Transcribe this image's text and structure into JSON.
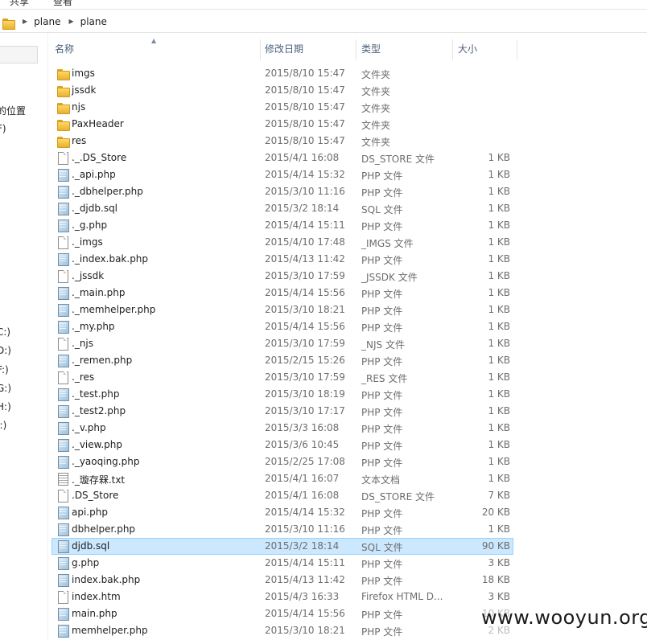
{
  "window": {
    "menu_items": [
      "共享",
      "查看"
    ]
  },
  "address_bar": {
    "breadcrumbs": [
      "plane",
      "plane"
    ]
  },
  "nav_pane": {
    "fragments": [
      "的位置",
      "F)",
      "C:)",
      "D:)",
      "F:)",
      "G:)",
      "H:)",
      "I:)"
    ]
  },
  "columns": {
    "name": "名称",
    "modified": "修改日期",
    "type": "类型",
    "size": "大小"
  },
  "files": [
    {
      "name": "imgs",
      "modified": "2015/8/10 15:47",
      "type": "文件夹",
      "size": "",
      "icon": "folder-icon"
    },
    {
      "name": "jssdk",
      "modified": "2015/8/10 15:47",
      "type": "文件夹",
      "size": "",
      "icon": "folder-icon"
    },
    {
      "name": "njs",
      "modified": "2015/8/10 15:47",
      "type": "文件夹",
      "size": "",
      "icon": "folder-icon"
    },
    {
      "name": "PaxHeader",
      "modified": "2015/8/10 15:47",
      "type": "文件夹",
      "size": "",
      "icon": "folder-icon"
    },
    {
      "name": "res",
      "modified": "2015/8/10 15:47",
      "type": "文件夹",
      "size": "",
      "icon": "folder-icon"
    },
    {
      "name": "._.DS_Store",
      "modified": "2015/4/1 16:08",
      "type": "DS_STORE 文件",
      "size": "1 KB",
      "icon": "file-icon"
    },
    {
      "name": "._api.php",
      "modified": "2015/4/14 15:32",
      "type": "PHP 文件",
      "size": "1 KB",
      "icon": "php-file-icon"
    },
    {
      "name": "._dbhelper.php",
      "modified": "2015/3/10 11:16",
      "type": "PHP 文件",
      "size": "1 KB",
      "icon": "php-file-icon"
    },
    {
      "name": "._djdb.sql",
      "modified": "2015/3/2 18:14",
      "type": "SQL 文件",
      "size": "1 KB",
      "icon": "php-file-icon"
    },
    {
      "name": "._g.php",
      "modified": "2015/4/14 15:11",
      "type": "PHP 文件",
      "size": "1 KB",
      "icon": "php-file-icon"
    },
    {
      "name": "._imgs",
      "modified": "2015/4/10 17:48",
      "type": "_IMGS 文件",
      "size": "1 KB",
      "icon": "file-icon"
    },
    {
      "name": "._index.bak.php",
      "modified": "2015/4/13 11:42",
      "type": "PHP 文件",
      "size": "1 KB",
      "icon": "php-file-icon"
    },
    {
      "name": "._jssdk",
      "modified": "2015/3/10 17:59",
      "type": "_JSSDK 文件",
      "size": "1 KB",
      "icon": "file-icon"
    },
    {
      "name": "._main.php",
      "modified": "2015/4/14 15:56",
      "type": "PHP 文件",
      "size": "1 KB",
      "icon": "php-file-icon"
    },
    {
      "name": "._memhelper.php",
      "modified": "2015/3/10 18:21",
      "type": "PHP 文件",
      "size": "1 KB",
      "icon": "php-file-icon"
    },
    {
      "name": "._my.php",
      "modified": "2015/4/14 15:56",
      "type": "PHP 文件",
      "size": "1 KB",
      "icon": "php-file-icon"
    },
    {
      "name": "._njs",
      "modified": "2015/3/10 17:59",
      "type": "_NJS 文件",
      "size": "1 KB",
      "icon": "file-icon"
    },
    {
      "name": "._remen.php",
      "modified": "2015/2/15 15:26",
      "type": "PHP 文件",
      "size": "1 KB",
      "icon": "php-file-icon"
    },
    {
      "name": "._res",
      "modified": "2015/3/10 17:59",
      "type": "_RES 文件",
      "size": "1 KB",
      "icon": "file-icon"
    },
    {
      "name": "._test.php",
      "modified": "2015/3/10 18:19",
      "type": "PHP 文件",
      "size": "1 KB",
      "icon": "php-file-icon"
    },
    {
      "name": "._test2.php",
      "modified": "2015/3/10 17:17",
      "type": "PHP 文件",
      "size": "1 KB",
      "icon": "php-file-icon"
    },
    {
      "name": "._v.php",
      "modified": "2015/3/3 16:08",
      "type": "PHP 文件",
      "size": "1 KB",
      "icon": "php-file-icon"
    },
    {
      "name": "._view.php",
      "modified": "2015/3/6 10:45",
      "type": "PHP 文件",
      "size": "1 KB",
      "icon": "php-file-icon"
    },
    {
      "name": "._yaoqing.php",
      "modified": "2015/2/25 17:08",
      "type": "PHP 文件",
      "size": "1 KB",
      "icon": "php-file-icon"
    },
    {
      "name": "._璇存槑.txt",
      "modified": "2015/4/1 16:07",
      "type": "文本文档",
      "size": "1 KB",
      "icon": "text-file-icon"
    },
    {
      "name": ".DS_Store",
      "modified": "2015/4/1 16:08",
      "type": "DS_STORE 文件",
      "size": "7 KB",
      "icon": "file-icon"
    },
    {
      "name": "api.php",
      "modified": "2015/4/14 15:32",
      "type": "PHP 文件",
      "size": "20 KB",
      "icon": "php-file-icon"
    },
    {
      "name": "dbhelper.php",
      "modified": "2015/3/10 11:16",
      "type": "PHP 文件",
      "size": "1 KB",
      "icon": "php-file-icon"
    },
    {
      "name": "djdb.sql",
      "modified": "2015/3/2 18:14",
      "type": "SQL 文件",
      "size": "90 KB",
      "icon": "php-file-icon",
      "selected": true
    },
    {
      "name": "g.php",
      "modified": "2015/4/14 15:11",
      "type": "PHP 文件",
      "size": "3 KB",
      "icon": "php-file-icon"
    },
    {
      "name": "index.bak.php",
      "modified": "2015/4/13 11:42",
      "type": "PHP 文件",
      "size": "18 KB",
      "icon": "php-file-icon"
    },
    {
      "name": "index.htm",
      "modified": "2015/4/3 16:33",
      "type": "Firefox HTML D...",
      "size": "3 KB",
      "icon": "file-icon"
    },
    {
      "name": "main.php",
      "modified": "2015/4/14 15:56",
      "type": "PHP 文件",
      "size": "10 KB",
      "icon": "php-file-icon"
    },
    {
      "name": "memhelper.php",
      "modified": "2015/3/10 18:21",
      "type": "PHP 文件",
      "size": "2 KB",
      "icon": "php-file-icon"
    }
  ],
  "watermark": {
    "text": "www.wooyun.org"
  },
  "colors": {
    "selection_bg": "#cce8ff",
    "selection_border": "#99d1ff",
    "header_text": "#4c607a",
    "meta_text": "#6d6d6d",
    "folder": "#e8b132"
  }
}
